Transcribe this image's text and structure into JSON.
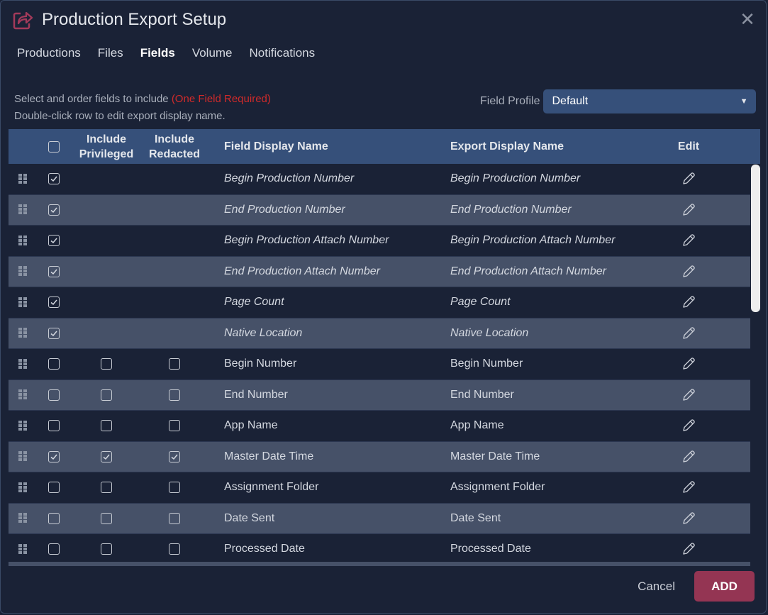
{
  "dialog": {
    "title": "Production Export Setup",
    "title_icon": "share-export-icon",
    "close_icon": "close-icon"
  },
  "tabs": [
    {
      "label": "Productions",
      "active": false
    },
    {
      "label": "Files",
      "active": false
    },
    {
      "label": "Fields",
      "active": true
    },
    {
      "label": "Volume",
      "active": false
    },
    {
      "label": "Notifications",
      "active": false
    }
  ],
  "instructions": {
    "line1": "Select and order fields to include ",
    "required": "(One Field Required)",
    "line2": "Double-click row to edit export display name."
  },
  "field_profile": {
    "label": "Field Profile",
    "value": "Default"
  },
  "table": {
    "headers": {
      "select_all_checked": false,
      "privileged_line1": "Include",
      "privileged_line2": "Privileged",
      "redacted_line1": "Include",
      "redacted_line2": "Redacted",
      "field_display_name": "Field Display Name",
      "export_display_name": "Export Display Name",
      "edit": "Edit"
    },
    "rows": [
      {
        "field": "Begin Production Number",
        "export": "Begin Production Number",
        "checked": true,
        "system": true,
        "privileged": null,
        "redacted": null
      },
      {
        "field": "End Production Number",
        "export": "End Production Number",
        "checked": true,
        "system": true,
        "privileged": null,
        "redacted": null
      },
      {
        "field": "Begin Production Attach Number",
        "export": "Begin Production Attach Number",
        "checked": true,
        "system": true,
        "privileged": null,
        "redacted": null
      },
      {
        "field": "End Production Attach Number",
        "export": "End Production Attach Number",
        "checked": true,
        "system": true,
        "privileged": null,
        "redacted": null
      },
      {
        "field": "Page Count",
        "export": "Page Count",
        "checked": true,
        "system": true,
        "privileged": null,
        "redacted": null
      },
      {
        "field": "Native Location",
        "export": "Native Location",
        "checked": true,
        "system": true,
        "privileged": null,
        "redacted": null
      },
      {
        "field": "Begin Number",
        "export": "Begin Number",
        "checked": false,
        "system": false,
        "privileged": false,
        "redacted": false
      },
      {
        "field": "End Number",
        "export": "End Number",
        "checked": false,
        "system": false,
        "privileged": false,
        "redacted": false
      },
      {
        "field": "App Name",
        "export": "App Name",
        "checked": false,
        "system": false,
        "privileged": false,
        "redacted": false
      },
      {
        "field": "Master Date Time",
        "export": "Master Date Time",
        "checked": true,
        "system": false,
        "privileged": true,
        "redacted": true
      },
      {
        "field": "Assignment Folder",
        "export": "Assignment Folder",
        "checked": false,
        "system": false,
        "privileged": false,
        "redacted": false
      },
      {
        "field": "Date Sent",
        "export": "Date Sent",
        "checked": false,
        "system": false,
        "privileged": false,
        "redacted": false
      },
      {
        "field": "Processed Date",
        "export": "Processed Date",
        "checked": false,
        "system": false,
        "privileged": false,
        "redacted": false
      }
    ]
  },
  "footer": {
    "cancel_label": "Cancel",
    "add_label": "ADD"
  },
  "colors": {
    "background": "#1a2236",
    "header": "#36507a",
    "row_alt": "#465168",
    "accent": "#943553",
    "required": "#d02a2a"
  }
}
